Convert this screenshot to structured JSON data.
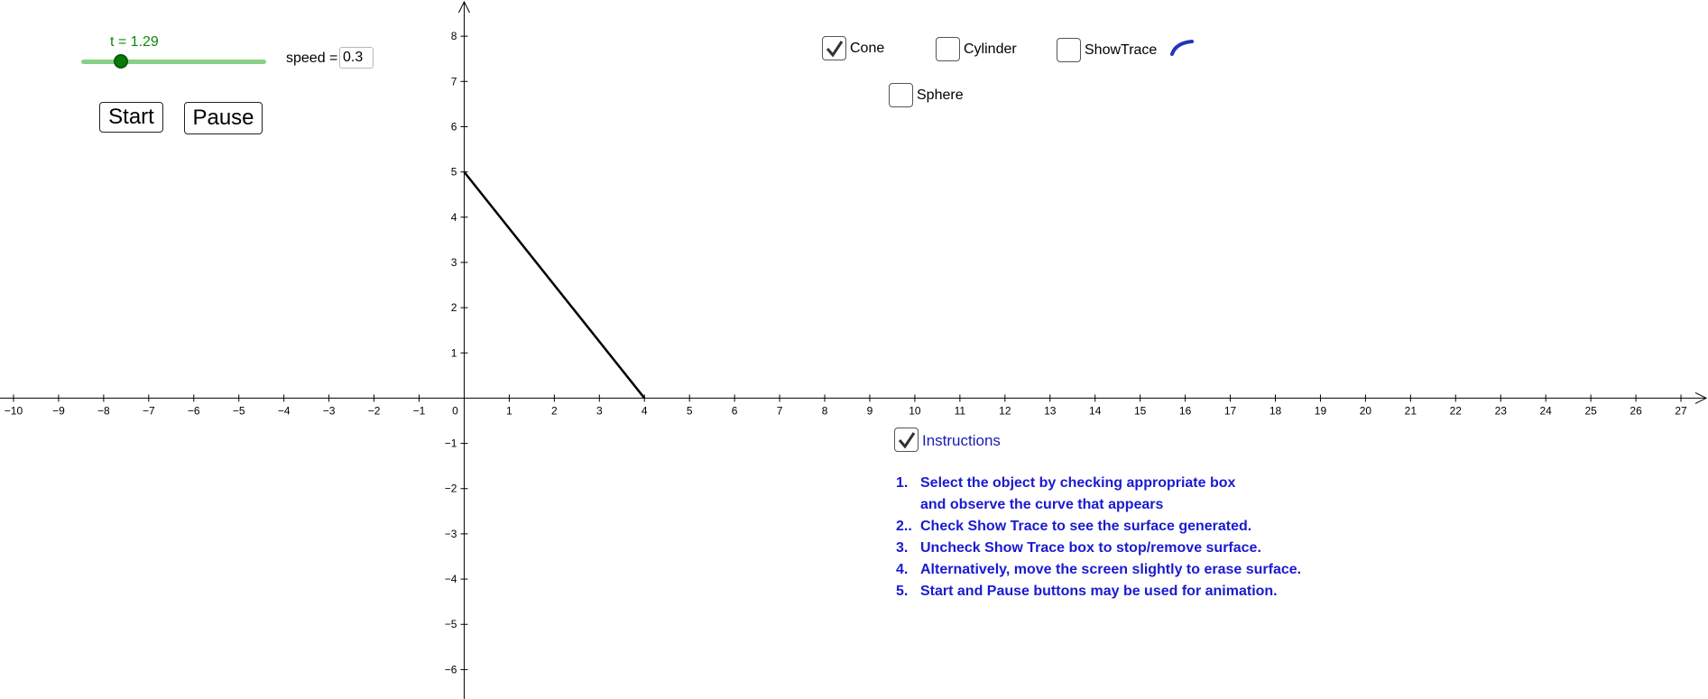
{
  "graph": {
    "x_ticks": [
      "−10",
      "−9",
      "−8",
      "−7",
      "−6",
      "−5",
      "−4",
      "−3",
      "−2",
      "−1",
      "0",
      "1",
      "2",
      "3",
      "4",
      "5",
      "6",
      "7",
      "8",
      "9",
      "10",
      "11",
      "12",
      "13",
      "14",
      "15",
      "16",
      "17",
      "18",
      "19",
      "20",
      "21",
      "22",
      "23",
      "24",
      "25",
      "26",
      "27"
    ],
    "y_ticks": [
      "8",
      "7",
      "6",
      "5",
      "4",
      "3",
      "2",
      "1",
      "−1",
      "−2",
      "−3",
      "−4",
      "−5",
      "−6"
    ],
    "x_range": [
      -10.3,
      27.6
    ],
    "y_range": [
      -6.65,
      8.8
    ],
    "segment": {
      "from": [
        0,
        5
      ],
      "to": [
        4,
        0
      ]
    },
    "colors": {
      "axis": "#000000",
      "segment": "#000000"
    }
  },
  "slider": {
    "label": "t = 1.29",
    "value": 1.29
  },
  "speed": {
    "label": "speed =",
    "value": "0.3"
  },
  "buttons": {
    "start": "Start",
    "pause": "Pause"
  },
  "checkboxes": {
    "cone": {
      "label": "Cone",
      "checked": true
    },
    "cylinder": {
      "label": "Cylinder",
      "checked": false
    },
    "showtrace": {
      "label": "ShowTrace",
      "checked": false
    },
    "sphere": {
      "label": "Sphere",
      "checked": false
    },
    "instructions": {
      "label": "Instructions",
      "checked": true
    }
  },
  "instructions": [
    {
      "num": "1.",
      "text": "Select the object by checking appropriate box"
    },
    {
      "num": "",
      "text": "and observe the curve that appears"
    },
    {
      "num": "2..",
      "text": "Check Show Trace to see the surface generated."
    },
    {
      "num": "3.",
      "text": "Uncheck Show Trace box to stop/remove surface."
    },
    {
      "num": "4.",
      "text": "Alternatively, move the screen slightly to erase surface."
    },
    {
      "num": "5.",
      "text": "Start and Pause buttons may be used for animation."
    }
  ],
  "colors": {
    "slider_label": "#0a8a0a",
    "instructions_text": "#1a1ad0",
    "trace_icon": "#2233bb"
  }
}
